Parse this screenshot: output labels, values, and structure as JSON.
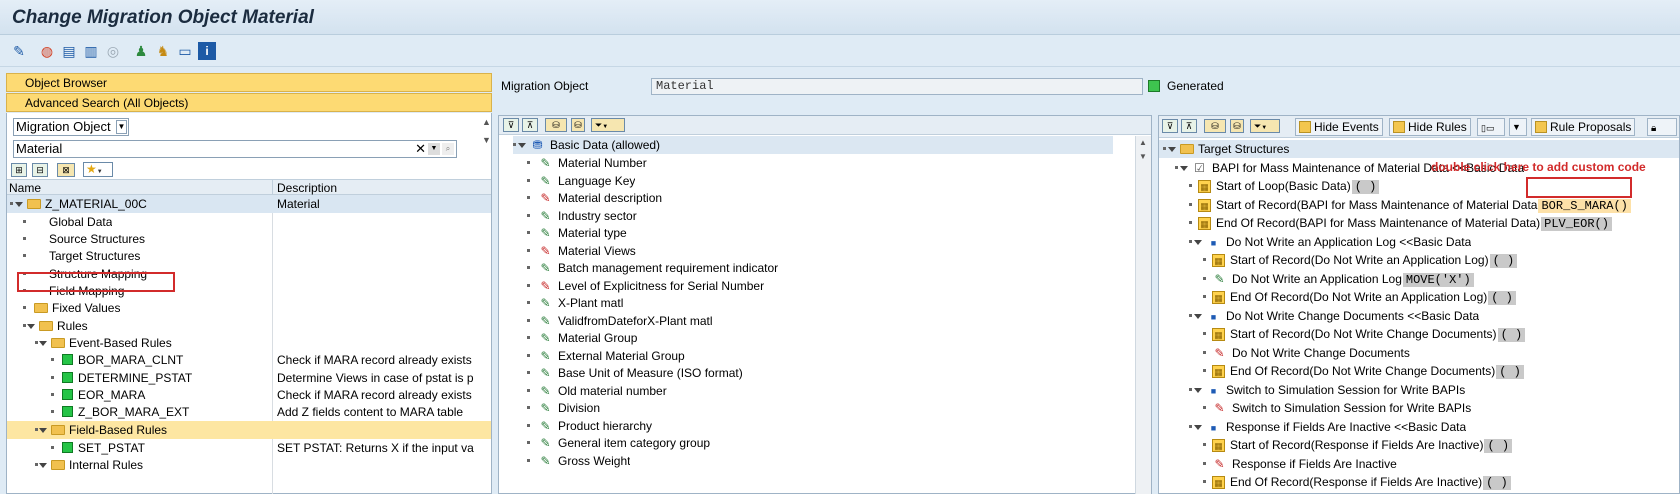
{
  "title": "Change Migration Object Material",
  "toolbar": {
    "icons": [
      "wand-icon",
      "object-icon",
      "display-icon",
      "print-icon",
      "target-icon",
      "user-icon",
      "users-icon",
      "layout-icon",
      "info-icon"
    ]
  },
  "left": {
    "object_browser": "Object Browser",
    "advanced_search": "Advanced Search (All Objects)",
    "search_type": "Migration Object",
    "search_value": "Material",
    "columns": [
      "Name",
      "Description"
    ],
    "tree": [
      {
        "name": "Z_MATERIAL_00C",
        "desc": "Material"
      },
      {
        "name": "Global Data",
        "desc": ""
      },
      {
        "name": "Source Structures",
        "desc": ""
      },
      {
        "name": "Target Structures",
        "desc": ""
      },
      {
        "name": "Structure Mapping",
        "desc": ""
      },
      {
        "name": "Field Mapping",
        "desc": ""
      },
      {
        "name": "Fixed Values",
        "desc": ""
      },
      {
        "name": "Rules",
        "desc": ""
      },
      {
        "name": "Event-Based Rules",
        "desc": ""
      },
      {
        "name": "BOR_MARA_CLNT",
        "desc": "Check if MARA record already exists"
      },
      {
        "name": "DETERMINE_PSTAT",
        "desc": "Determine Views in case of pstat is p"
      },
      {
        "name": "EOR_MARA",
        "desc": "Check if MARA record already exists"
      },
      {
        "name": "Z_BOR_MARA_EXT",
        "desc": "Add Z fields content to MARA table"
      },
      {
        "name": "Field-Based Rules",
        "desc": ""
      },
      {
        "name": "SET_PSTAT",
        "desc": "SET PSTAT: Returns X if the input va"
      },
      {
        "name": "Internal Rules",
        "desc": ""
      }
    ]
  },
  "migration": {
    "label": "Migration Object",
    "value": "Material",
    "status": "Generated"
  },
  "middle": {
    "root": "Basic Data (allowed)",
    "fields": [
      "Material Number",
      "Language Key",
      "Material description",
      "Industry sector",
      "Material type",
      "Material Views",
      "Batch management requirement indicator",
      "Level of Explicitness for Serial Number",
      "X-Plant matl",
      "ValidfromDateforX-Plant matl",
      "Material Group",
      "External Material Group",
      "Base Unit of Measure (ISO format)",
      "Old material number",
      "Division",
      "Product hierarchy",
      "General item category group",
      "Gross Weight"
    ]
  },
  "right": {
    "buttons": {
      "hide_events": "Hide Events",
      "hide_rules": "Hide Rules",
      "rule_proposals": "Rule Proposals"
    },
    "annotation": "double click here to add custom code",
    "rows": [
      {
        "text": "Target Structures",
        "code": ""
      },
      {
        "text": "BAPI for Mass Maintenance of Material Data <<Basic Data",
        "code": ""
      },
      {
        "text": "Start of Loop(Basic Data)",
        "code": "( )"
      },
      {
        "text": "Start of Record(BAPI for Mass Maintenance of Material Data",
        "code": "BOR_S_MARA()"
      },
      {
        "text": "End Of Record(BAPI for Mass Maintenance of Material Data)",
        "code": "PLV_EOR()"
      },
      {
        "text": "Do Not Write an Application Log <<Basic Data",
        "code": ""
      },
      {
        "text": "Start of Record(Do Not Write an Application Log)",
        "code": "( )"
      },
      {
        "text": "Do Not Write an Application Log",
        "code": "MOVE('X')"
      },
      {
        "text": "End Of Record(Do Not Write an Application Log)",
        "code": "( )"
      },
      {
        "text": "Do Not Write Change Documents <<Basic Data",
        "code": ""
      },
      {
        "text": "Start of Record(Do Not Write Change Documents)",
        "code": "( )"
      },
      {
        "text": "Do Not Write Change Documents",
        "code": ""
      },
      {
        "text": "End Of Record(Do Not Write Change Documents)",
        "code": "( )"
      },
      {
        "text": "Switch to Simulation Session for Write BAPIs",
        "code": ""
      },
      {
        "text": "Switch to Simulation Session for Write BAPIs",
        "code": ""
      },
      {
        "text": "Response if Fields Are Inactive <<Basic Data",
        "code": ""
      },
      {
        "text": "Start of Record(Response if Fields Are Inactive)",
        "code": "( )"
      },
      {
        "text": "Response if Fields Are Inactive",
        "code": ""
      },
      {
        "text": "End Of Record(Response if Fields Are Inactive)",
        "code": "( )"
      }
    ]
  }
}
